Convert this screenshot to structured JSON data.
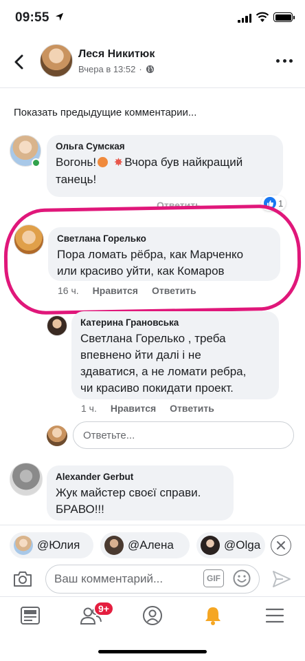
{
  "status": {
    "time": "09:55"
  },
  "header": {
    "name": "Леся Никитюк",
    "time": "Вчера в 13:52",
    "dot": "·"
  },
  "show_previous": "Показать предыдущие комментарии...",
  "comments": [
    {
      "name": "Ольга Сумская",
      "text1": "Вогонь!",
      "text2": "Вчора був найкращий",
      "text3": "танець!",
      "reply_label": "Ответить",
      "reaction_count": "1"
    },
    {
      "name": "Светлана Горелько",
      "text1": "Пора ломать рёбра, как Марченко",
      "text2": "или красиво уйти, как Комаров",
      "time": "16 ч.",
      "like_label": "Нравится",
      "reply_label": "Ответить"
    },
    {
      "name": "Катерина Грановська",
      "text1": "Светлана Горелько , треба",
      "text2": "впевнено йти далі і не",
      "text3": "здаватися, а не ломати ребра,",
      "text4": "чи красиво покидати проект.",
      "time": "1 ч.",
      "like_label": "Нравится",
      "reply_label": "Ответить"
    },
    {
      "name": "Alexander Gerbut",
      "text1": "Жук майстер своєї справи.",
      "text2": "БРАВО!!!"
    }
  ],
  "reply_placeholder": "Ответьте...",
  "mentions": [
    "@Юлия",
    "@Алена",
    "@Olga"
  ],
  "composer": {
    "placeholder": "Ваш комментарий...",
    "gif": "GIF"
  },
  "tabbar": {
    "friends_badge": "9+"
  },
  "colors": {
    "accent": "#1877f2",
    "highlight": "#e0177a",
    "badge": "#e41e3f"
  }
}
